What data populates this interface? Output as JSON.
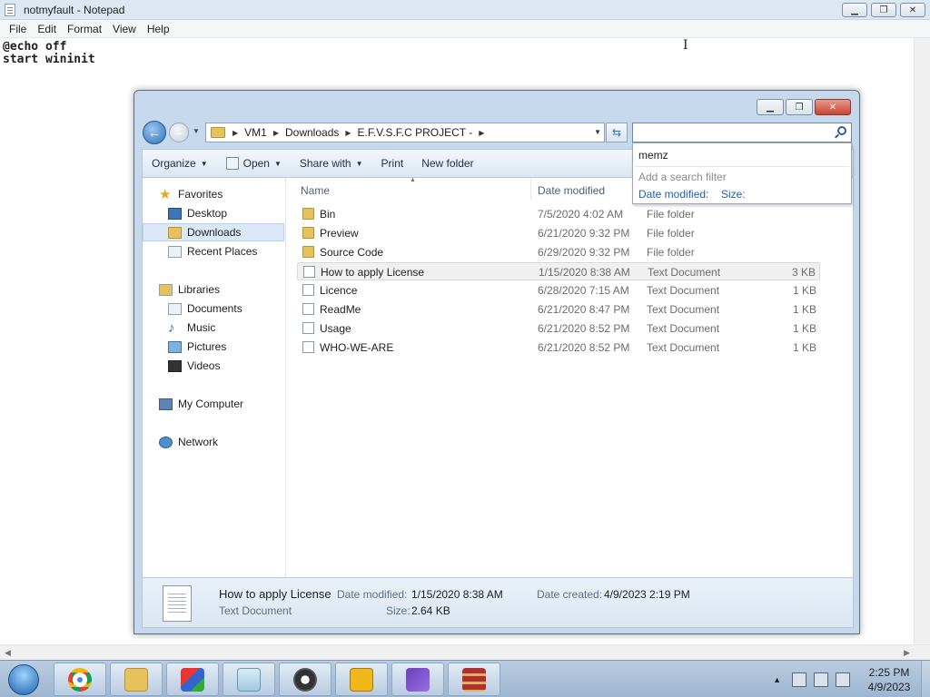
{
  "notepad": {
    "title": "notmyfault - Notepad",
    "menu": [
      "File",
      "Edit",
      "Format",
      "View",
      "Help"
    ],
    "content": "@echo off\nstart wininit"
  },
  "explorer": {
    "breadcrumb": [
      "VM1",
      "Downloads",
      "E.F.V.S.F.C PROJECT -"
    ],
    "search": {
      "value": ""
    },
    "suggest": {
      "item": "memz",
      "hint": "Add a search filter",
      "filter_date": "Date modified:",
      "filter_size": "Size:"
    },
    "toolbar": {
      "organize": "Organize",
      "open": "Open",
      "share": "Share with",
      "print": "Print",
      "new_folder": "New folder"
    },
    "nav": {
      "favorites": "Favorites",
      "desktop": "Desktop",
      "downloads": "Downloads",
      "recent": "Recent Places",
      "libraries": "Libraries",
      "documents": "Documents",
      "music": "Music",
      "pictures": "Pictures",
      "videos": "Videos",
      "computer": "My Computer",
      "network": "Network"
    },
    "columns": {
      "name": "Name",
      "date": "Date modified"
    },
    "files": [
      {
        "name": "Bin",
        "date": "7/5/2020 4:02 AM",
        "type": "File folder",
        "size": ""
      },
      {
        "name": "Preview",
        "date": "6/21/2020 9:32 PM",
        "type": "File folder",
        "size": ""
      },
      {
        "name": "Source Code",
        "date": "6/29/2020 9:32 PM",
        "type": "File folder",
        "size": ""
      },
      {
        "name": "How to apply License",
        "date": "1/15/2020 8:38 AM",
        "type": "Text Document",
        "size": "3 KB"
      },
      {
        "name": "Licence",
        "date": "6/28/2020 7:15 AM",
        "type": "Text Document",
        "size": "1 KB"
      },
      {
        "name": "ReadMe",
        "date": "6/21/2020 8:47 PM",
        "type": "Text Document",
        "size": "1 KB"
      },
      {
        "name": "Usage",
        "date": "6/21/2020 8:52 PM",
        "type": "Text Document",
        "size": "1 KB"
      },
      {
        "name": "WHO-WE-ARE",
        "date": "6/21/2020 8:52 PM",
        "type": "Text Document",
        "size": "1 KB"
      }
    ],
    "details": {
      "name": "How to apply License",
      "type": "Text Document",
      "modified_label": "Date modified:",
      "modified": "1/15/2020 8:38 AM",
      "created_label": "Date created:",
      "created": "4/9/2023 2:19 PM",
      "size_label": "Size:",
      "size": "2.64 KB"
    }
  },
  "taskbar": {
    "time": "2:25 PM",
    "date": "4/9/2023",
    "apps": [
      "chrome",
      "file-explorer",
      "paint-3d",
      "notepad",
      "settings",
      "rockstar",
      "visual-studio",
      "winrar"
    ]
  }
}
